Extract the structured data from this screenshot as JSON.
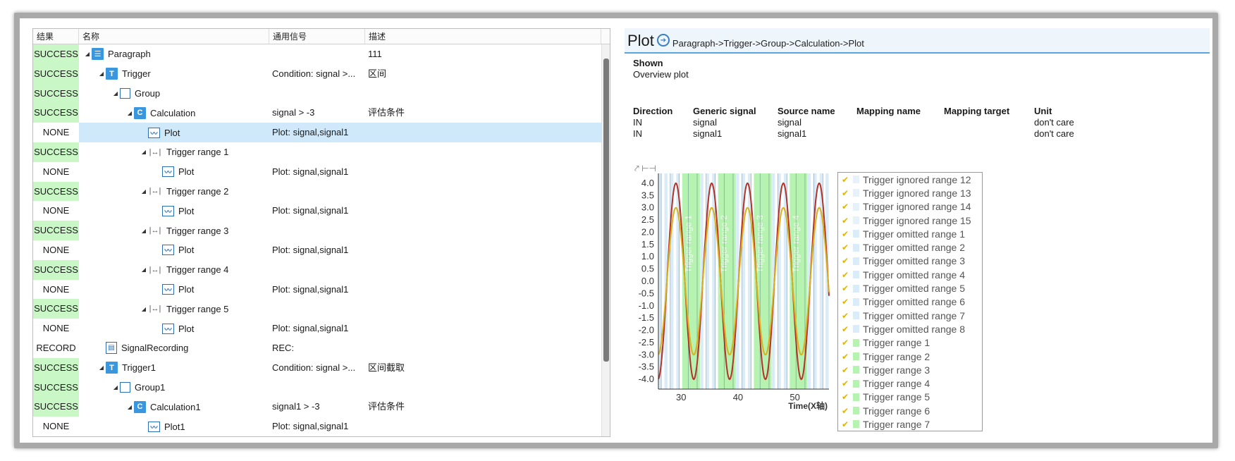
{
  "tree": {
    "headers": {
      "result": "结果",
      "name": "名称",
      "signal": "通用信号",
      "description": "描述"
    },
    "rows": [
      {
        "result": "SUCCESS",
        "ok": true,
        "indent": 0,
        "expand": true,
        "icon": "list-icon",
        "name": "Paragraph",
        "signal": "",
        "desc": "111"
      },
      {
        "result": "SUCCESS",
        "ok": true,
        "indent": 1,
        "expand": true,
        "icon": "trigger-icon",
        "name": "Trigger",
        "signal": "Condition: signal >...",
        "desc": "区间"
      },
      {
        "result": "SUCCESS",
        "ok": true,
        "indent": 2,
        "expand": true,
        "icon": "group-icon",
        "name": "Group",
        "signal": "",
        "desc": ""
      },
      {
        "result": "SUCCESS",
        "ok": true,
        "indent": 3,
        "expand": true,
        "icon": "calculation-icon",
        "name": "Calculation",
        "signal": "signal > -3",
        "desc": "评估条件"
      },
      {
        "result": "NONE",
        "ok": false,
        "indent": 4,
        "expand": false,
        "icon": "plot-icon",
        "name": "Plot",
        "signal": "Plot: signal,signal1",
        "desc": "",
        "selected": true
      },
      {
        "result": "SUCCESS",
        "ok": true,
        "indent": 4,
        "expand": true,
        "icon": "range-icon",
        "name": "Trigger range 1",
        "signal": "",
        "desc": ""
      },
      {
        "result": "NONE",
        "ok": false,
        "indent": 5,
        "expand": false,
        "icon": "plot-icon",
        "name": "Plot",
        "signal": "Plot: signal,signal1",
        "desc": ""
      },
      {
        "result": "SUCCESS",
        "ok": true,
        "indent": 4,
        "expand": true,
        "icon": "range-icon",
        "name": "Trigger range 2",
        "signal": "",
        "desc": ""
      },
      {
        "result": "NONE",
        "ok": false,
        "indent": 5,
        "expand": false,
        "icon": "plot-icon",
        "name": "Plot",
        "signal": "Plot: signal,signal1",
        "desc": ""
      },
      {
        "result": "SUCCESS",
        "ok": true,
        "indent": 4,
        "expand": true,
        "icon": "range-icon",
        "name": "Trigger range 3",
        "signal": "",
        "desc": ""
      },
      {
        "result": "NONE",
        "ok": false,
        "indent": 5,
        "expand": false,
        "icon": "plot-icon",
        "name": "Plot",
        "signal": "Plot: signal,signal1",
        "desc": ""
      },
      {
        "result": "SUCCESS",
        "ok": true,
        "indent": 4,
        "expand": true,
        "icon": "range-icon",
        "name": "Trigger range 4",
        "signal": "",
        "desc": ""
      },
      {
        "result": "NONE",
        "ok": false,
        "indent": 5,
        "expand": false,
        "icon": "plot-icon",
        "name": "Plot",
        "signal": "Plot: signal,signal1",
        "desc": ""
      },
      {
        "result": "SUCCESS",
        "ok": true,
        "indent": 4,
        "expand": true,
        "icon": "range-icon",
        "name": "Trigger range 5",
        "signal": "",
        "desc": ""
      },
      {
        "result": "NONE",
        "ok": false,
        "indent": 5,
        "expand": false,
        "icon": "plot-icon",
        "name": "Plot",
        "signal": "Plot: signal,signal1",
        "desc": ""
      },
      {
        "result": "RECORD",
        "ok": false,
        "indent": 1,
        "expand": false,
        "icon": "recording-icon",
        "name": "SignalRecording",
        "signal": "REC:",
        "desc": ""
      },
      {
        "result": "SUCCESS",
        "ok": true,
        "indent": 1,
        "expand": true,
        "icon": "trigger-icon",
        "name": "Trigger1",
        "signal": "Condition: signal >...",
        "desc": "区间截取"
      },
      {
        "result": "SUCCESS",
        "ok": true,
        "indent": 2,
        "expand": true,
        "icon": "group-icon",
        "name": "Group1",
        "signal": "",
        "desc": ""
      },
      {
        "result": "SUCCESS",
        "ok": true,
        "indent": 3,
        "expand": true,
        "icon": "calculation-icon",
        "name": "Calculation1",
        "signal": "signal1 > -3",
        "desc": "评估条件"
      },
      {
        "result": "NONE",
        "ok": false,
        "indent": 4,
        "expand": false,
        "icon": "plot-icon",
        "name": "Plot1",
        "signal": "Plot: signal,signal1",
        "desc": ""
      }
    ]
  },
  "detail": {
    "title": "Plot",
    "path": "Paragraph->Trigger->Group->Calculation->Plot",
    "shown_label": "Shown",
    "shown_value": "Overview plot",
    "mapping": {
      "headers": [
        "Direction",
        "Generic signal",
        "Source name",
        "Mapping name",
        "Mapping target",
        "Unit"
      ],
      "rows": [
        [
          "IN",
          "signal",
          "signal",
          "",
          "",
          "don't care"
        ],
        [
          "IN",
          "signal1",
          "signal1",
          "",
          "",
          "don't care"
        ]
      ]
    }
  },
  "chart_data": {
    "type": "line",
    "xlabel": "Time(X轴)",
    "ylabel": "",
    "xlim": [
      26,
      56
    ],
    "ylim": [
      -4.4,
      4.4
    ],
    "x_ticks": [
      30,
      40,
      50
    ],
    "y_ticks": [
      "4.0",
      "3.5",
      "3.0",
      "2.5",
      "2.0",
      "1.5",
      "1.0",
      "0.5",
      "0.0",
      "-0.5",
      "-1.0",
      "-1.5",
      "-2.0",
      "-2.5",
      "-3.0",
      "-3.5",
      "-4.0"
    ],
    "series": [
      {
        "name": "signal",
        "amplitude": 4.0,
        "period": 6.3,
        "color": "#b5312a"
      },
      {
        "name": "signal1",
        "amplitude": 3.0,
        "period": 6.3,
        "color": "#d8b21c"
      }
    ],
    "trigger_ranges": [
      {
        "label": "Trigger range 1",
        "x0": 30.2,
        "x1": 33.3
      },
      {
        "label": "Trigger range 2",
        "x0": 36.5,
        "x1": 39.6
      },
      {
        "label": "Trigger range 3",
        "x0": 42.8,
        "x1": 45.9
      },
      {
        "label": "Trigger range 4",
        "x0": 49.1,
        "x1": 52.2
      }
    ],
    "legend": [
      "Trigger ignored range 12",
      "Trigger ignored range 13",
      "Trigger ignored range 14",
      "Trigger ignored range 15",
      "Trigger omitted range 1",
      "Trigger omitted range 2",
      "Trigger omitted range 3",
      "Trigger omitted range 4",
      "Trigger omitted range 5",
      "Trigger omitted range 6",
      "Trigger omitted range 7",
      "Trigger omitted range 8",
      "Trigger range 1",
      "Trigger range 2",
      "Trigger range 3",
      "Trigger range 4",
      "Trigger range 5",
      "Trigger range 6",
      "Trigger range 7"
    ],
    "colors": {
      "range_fill": "#b6f3b0",
      "omitted_fill": "#d9ecf7",
      "ignored_fill": "#e6f1fa"
    }
  }
}
